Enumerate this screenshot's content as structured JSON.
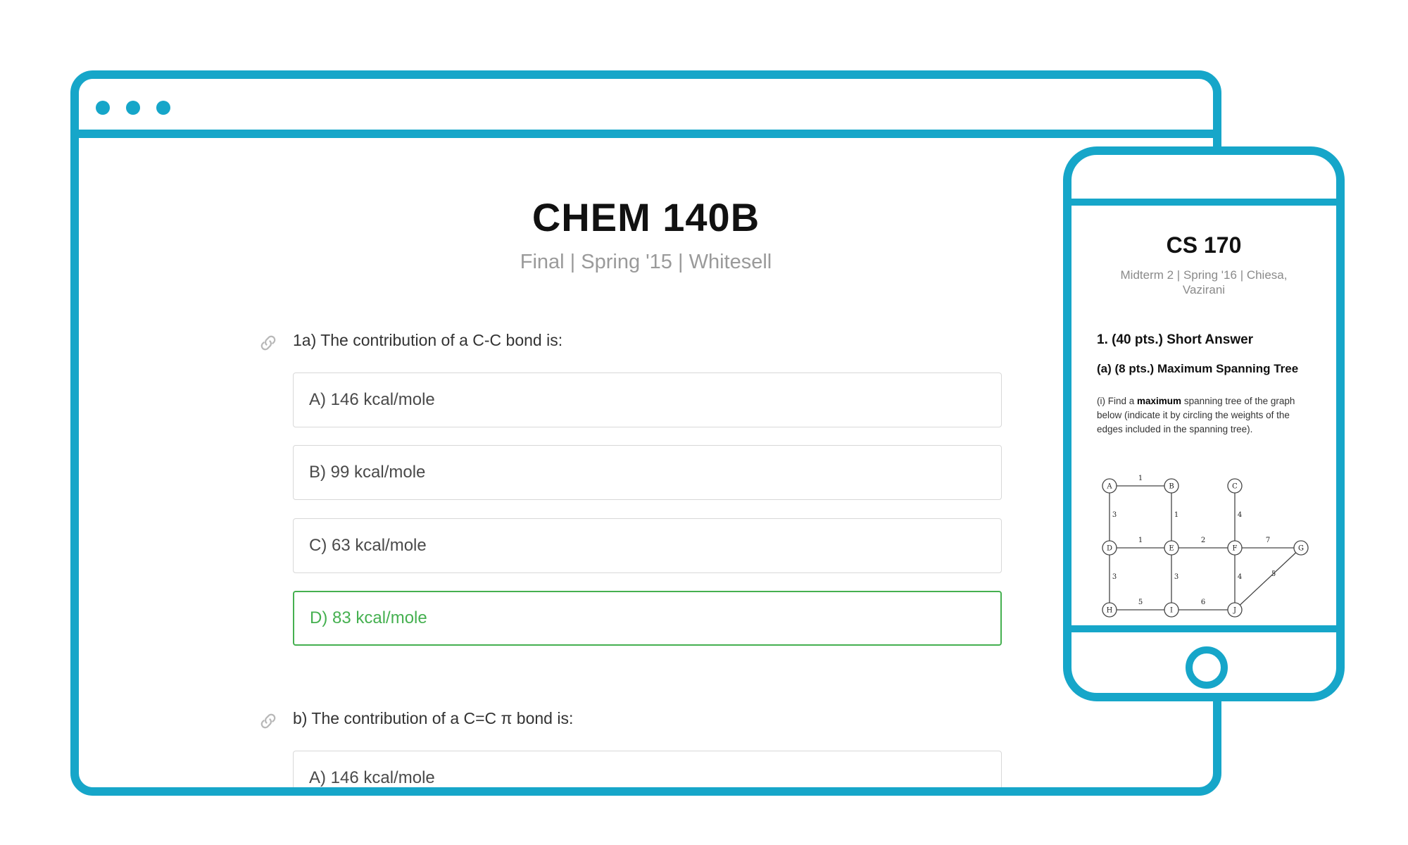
{
  "browser": {
    "exam_title": "CHEM 140B",
    "exam_subtitle": "Final | Spring '15 | Whitesell",
    "questions": [
      {
        "label": "1a) The contribution of a C-C bond is:",
        "options": [
          "A) 146 kcal/mole",
          "B) 99 kcal/mole",
          "C) 63 kcal/mole",
          "D) 83 kcal/mole"
        ],
        "correct_option": "D"
      },
      {
        "label": "b) The contribution of a C=C π bond is:",
        "options": [
          "A) 146 kcal/mole"
        ]
      }
    ]
  },
  "phone": {
    "exam_title": "CS 170",
    "exam_subtitle": "Midterm 2 | Spring '16 | Chiesa, Vazirani",
    "question_heading": "1. (40 pts.) Short Answer",
    "subquestion_heading": "(a) (8 pts.) Maximum Spanning Tree",
    "instructions_prefix": "(i) Find a",
    "instructions_bold": "maximum",
    "instructions_suffix": "spanning tree of the graph below (indicate it by circling the weights of the edges included in the spanning tree).",
    "graph": {
      "nodes": [
        "A",
        "B",
        "C",
        "D",
        "E",
        "F",
        "G",
        "H",
        "I",
        "J"
      ],
      "edges": [
        {
          "from": "A",
          "to": "B",
          "weight": "1"
        },
        {
          "from": "A",
          "to": "D",
          "weight": "3"
        },
        {
          "from": "B",
          "to": "E",
          "weight": "1"
        },
        {
          "from": "C",
          "to": "F",
          "weight": "4"
        },
        {
          "from": "D",
          "to": "E",
          "weight": "1"
        },
        {
          "from": "E",
          "to": "F",
          "weight": "2"
        },
        {
          "from": "F",
          "to": "G",
          "weight": "7"
        },
        {
          "from": "D",
          "to": "H",
          "weight": "3"
        },
        {
          "from": "E",
          "to": "I",
          "weight": "3"
        },
        {
          "from": "F",
          "to": "J",
          "weight": "4"
        },
        {
          "from": "G",
          "to": "J",
          "weight": "5"
        },
        {
          "from": "H",
          "to": "I",
          "weight": "5"
        },
        {
          "from": "I",
          "to": "J",
          "weight": "6"
        }
      ]
    }
  },
  "colors": {
    "frame": "#16a6c9",
    "correct": "#45b050"
  }
}
